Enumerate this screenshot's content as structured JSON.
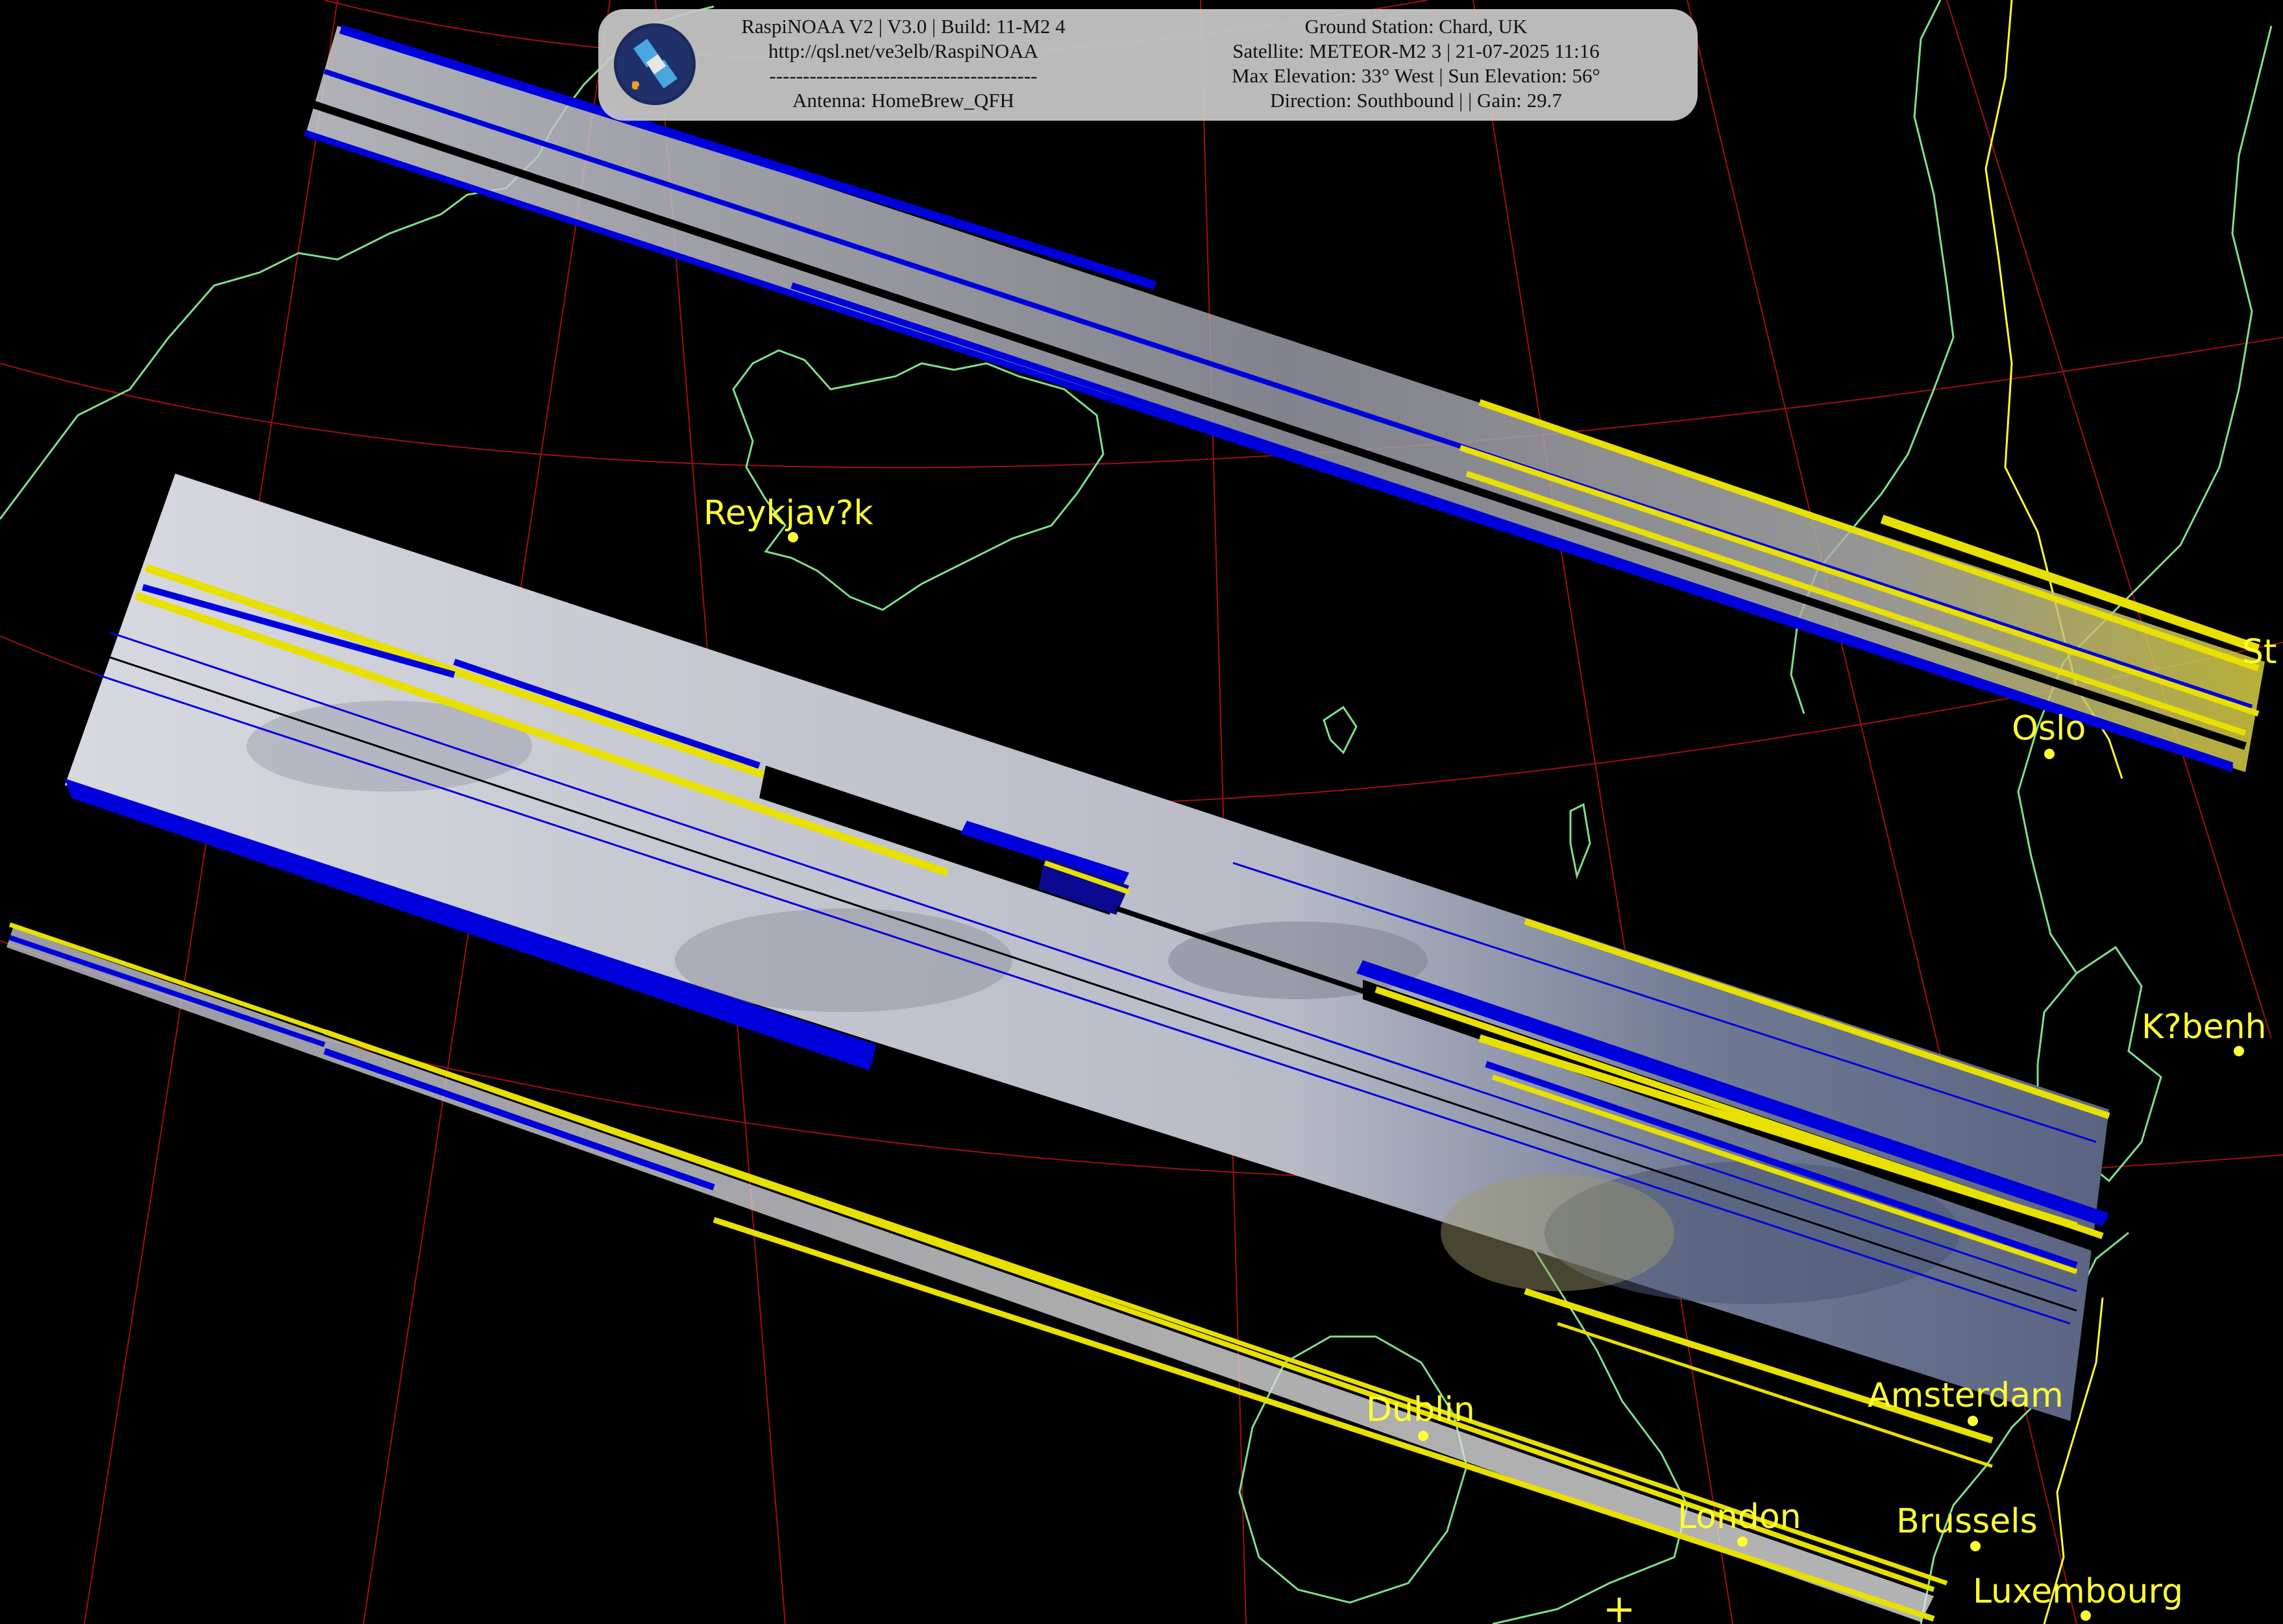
{
  "header": {
    "left_lines": [
      "RaspiNOAA V2 | V3.0 | Build: 11-M2 4",
      "http://qsl.net/ve3elb/RaspiNOAA",
      "----------------------------------------",
      "Antenna: HomeBrew_QFH"
    ],
    "right_lines": [
      "Ground Station: Chard, UK",
      "Satellite: METEOR-M2 3 | 21-07-2025 11:16",
      "Max Elevation: 33° West | Sun Elevation: 56°",
      "Direction: Southbound | | Gain: 29.7"
    ]
  },
  "cities": [
    {
      "name": "Reykjav?k"
    },
    {
      "name": "Oslo"
    },
    {
      "name": "St"
    },
    {
      "name": "K?benh"
    },
    {
      "name": "Dublin"
    },
    {
      "name": "Amsterdam"
    },
    {
      "name": "London"
    },
    {
      "name": "Brussels"
    },
    {
      "name": "Luxembourg"
    }
  ],
  "colors": {
    "background": "#000000",
    "coastline": "#7fe08a",
    "border": "#ffff33",
    "graticule": "#a01010",
    "city": "#ffff33",
    "gap_blue": "#0000dd",
    "gap_yellow": "#e8e000",
    "cloud": "#c8cad4"
  },
  "ground_station_marker": "+"
}
